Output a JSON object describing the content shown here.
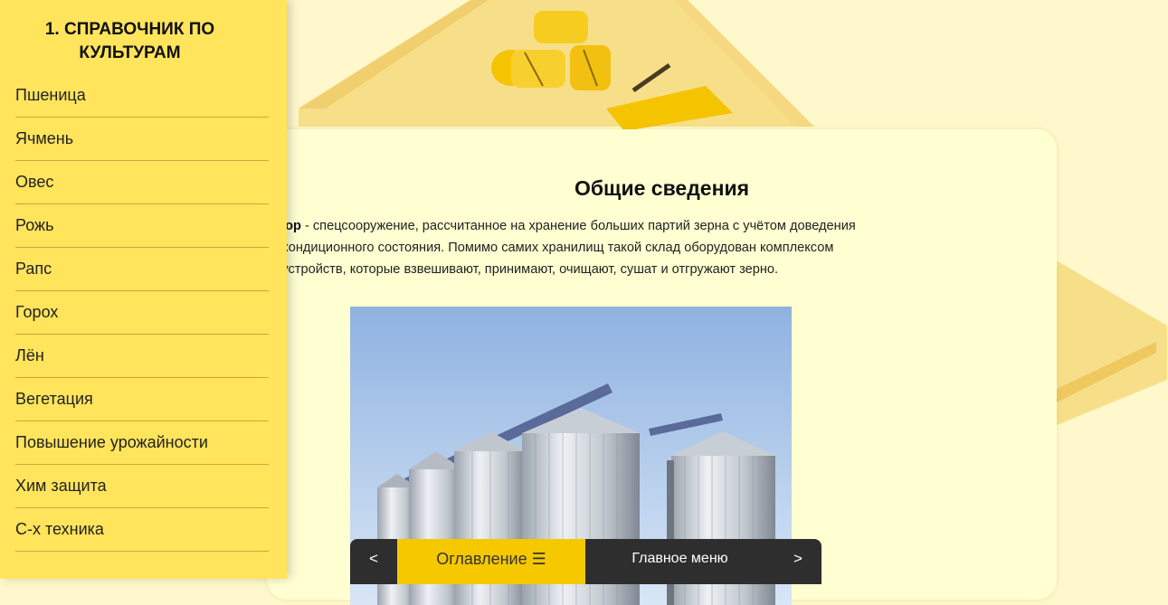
{
  "sidebar": {
    "title": "1. СПРАВОЧНИК ПО КУЛЬТУРАМ",
    "items": [
      {
        "label": "Пшеница"
      },
      {
        "label": "Ячмень"
      },
      {
        "label": "Овес"
      },
      {
        "label": "Рожь"
      },
      {
        "label": "Рапс"
      },
      {
        "label": "Горох"
      },
      {
        "label": "Лён"
      },
      {
        "label": "Вегетация"
      },
      {
        "label": "Повышение урожайности"
      },
      {
        "label": "Хим защита"
      },
      {
        "label": "С-х техника"
      }
    ]
  },
  "content": {
    "title": "Общие сведения",
    "term_visible": "атор",
    "text_line1": " - спецсооружение, рассчитанное на хранение больших партий зерна с учётом доведения",
    "text_line2": "о кондиционного состояния. Помимо самих хранилищ такой склад оборудован комплексом",
    "text_line3": "х устройств, которые взвешивают, принимают, очищают, сушат и отгружают зерно."
  },
  "bottom_nav": {
    "prev": "<",
    "toc": "Оглавление ☰",
    "main_menu": "Главное меню",
    "next": ">"
  },
  "colors": {
    "sidebar_bg": "#ffe45c",
    "page_bg": "#fff8cc",
    "card_bg": "#ffffd2",
    "nav_bg": "#2e2e2e",
    "nav_accent": "#f5c800"
  }
}
